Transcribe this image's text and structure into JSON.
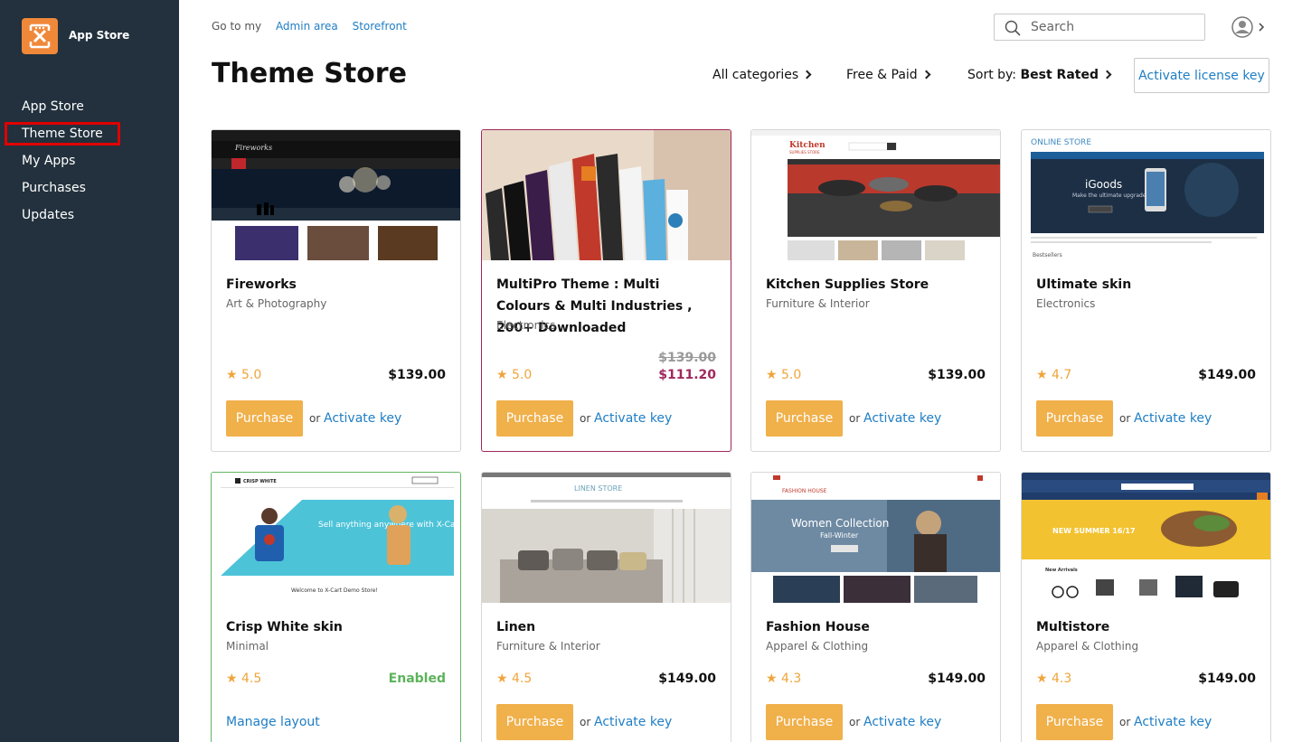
{
  "sidebar": {
    "app_name": "App Store",
    "items": [
      {
        "label": "App Store"
      },
      {
        "label": "Theme Store"
      },
      {
        "label": "My Apps"
      },
      {
        "label": "Purchases"
      },
      {
        "label": "Updates"
      }
    ]
  },
  "topbar": {
    "goto_label": "Go to my",
    "admin_link": "Admin area",
    "storefront_link": "Storefront",
    "search_placeholder": "Search"
  },
  "header": {
    "title": "Theme Store",
    "categories_filter": "All categories",
    "price_filter": "Free & Paid",
    "sort_label": "Sort by:",
    "sort_value": "Best Rated",
    "license_button": "Activate license key"
  },
  "common": {
    "purchase": "Purchase",
    "or": "or",
    "activate_key": "Activate key",
    "manage_layout": "Manage layout",
    "enabled": "Enabled"
  },
  "themes": [
    {
      "name": "Fireworks",
      "category": "Art & Photography",
      "rating": "5.0",
      "price": "$139.00"
    },
    {
      "name": "MultiPro Theme : Multi Colours & Multi Industries , 200+ Downloaded",
      "category": "Electronics",
      "rating": "5.0",
      "old_price": "$139.00",
      "price": "$111.20"
    },
    {
      "name": "Kitchen Supplies Store",
      "category": "Furniture & Interior",
      "rating": "5.0",
      "price": "$139.00"
    },
    {
      "name": "Ultimate skin",
      "category": "Electronics",
      "rating": "4.7",
      "price": "$149.00"
    },
    {
      "name": "Crisp White skin",
      "category": "Minimal",
      "rating": "4.5",
      "status": "Enabled"
    },
    {
      "name": "Linen",
      "category": "Furniture & Interior",
      "rating": "4.5",
      "price": "$149.00"
    },
    {
      "name": "Fashion House",
      "category": "Apparel & Clothing",
      "rating": "4.3",
      "price": "$149.00"
    },
    {
      "name": "Multistore",
      "category": "Apparel & Clothing",
      "rating": "4.3",
      "price": "$149.00"
    }
  ],
  "previews": {
    "fireworks_logo": "Fireworks",
    "kitchen_logo": "Kitchen",
    "kitchen_sub": "SUPPLIES STORE",
    "ultimate_logo": "ONLINE STORE",
    "ultimate_hero": "iGoods",
    "ultimate_tagline": "Make the ultimate upgrade",
    "ultimate_bestsellers": "Bestsellers",
    "crisp_logo": "CRISP WHITE",
    "crisp_hero": "Sell anything anywhere with X-Cart",
    "crisp_welcome": "Welcome to X-Cart Demo Store!",
    "linen_logo": "LINEN STORE",
    "fashion_logo": "FASHION HOUSE",
    "fashion_hero": "Women Collection",
    "fashion_sub": "Fall-Winter",
    "multi_banner": "NEW SUMMER 16/17",
    "multi_arrivals": "New Arrivals"
  }
}
